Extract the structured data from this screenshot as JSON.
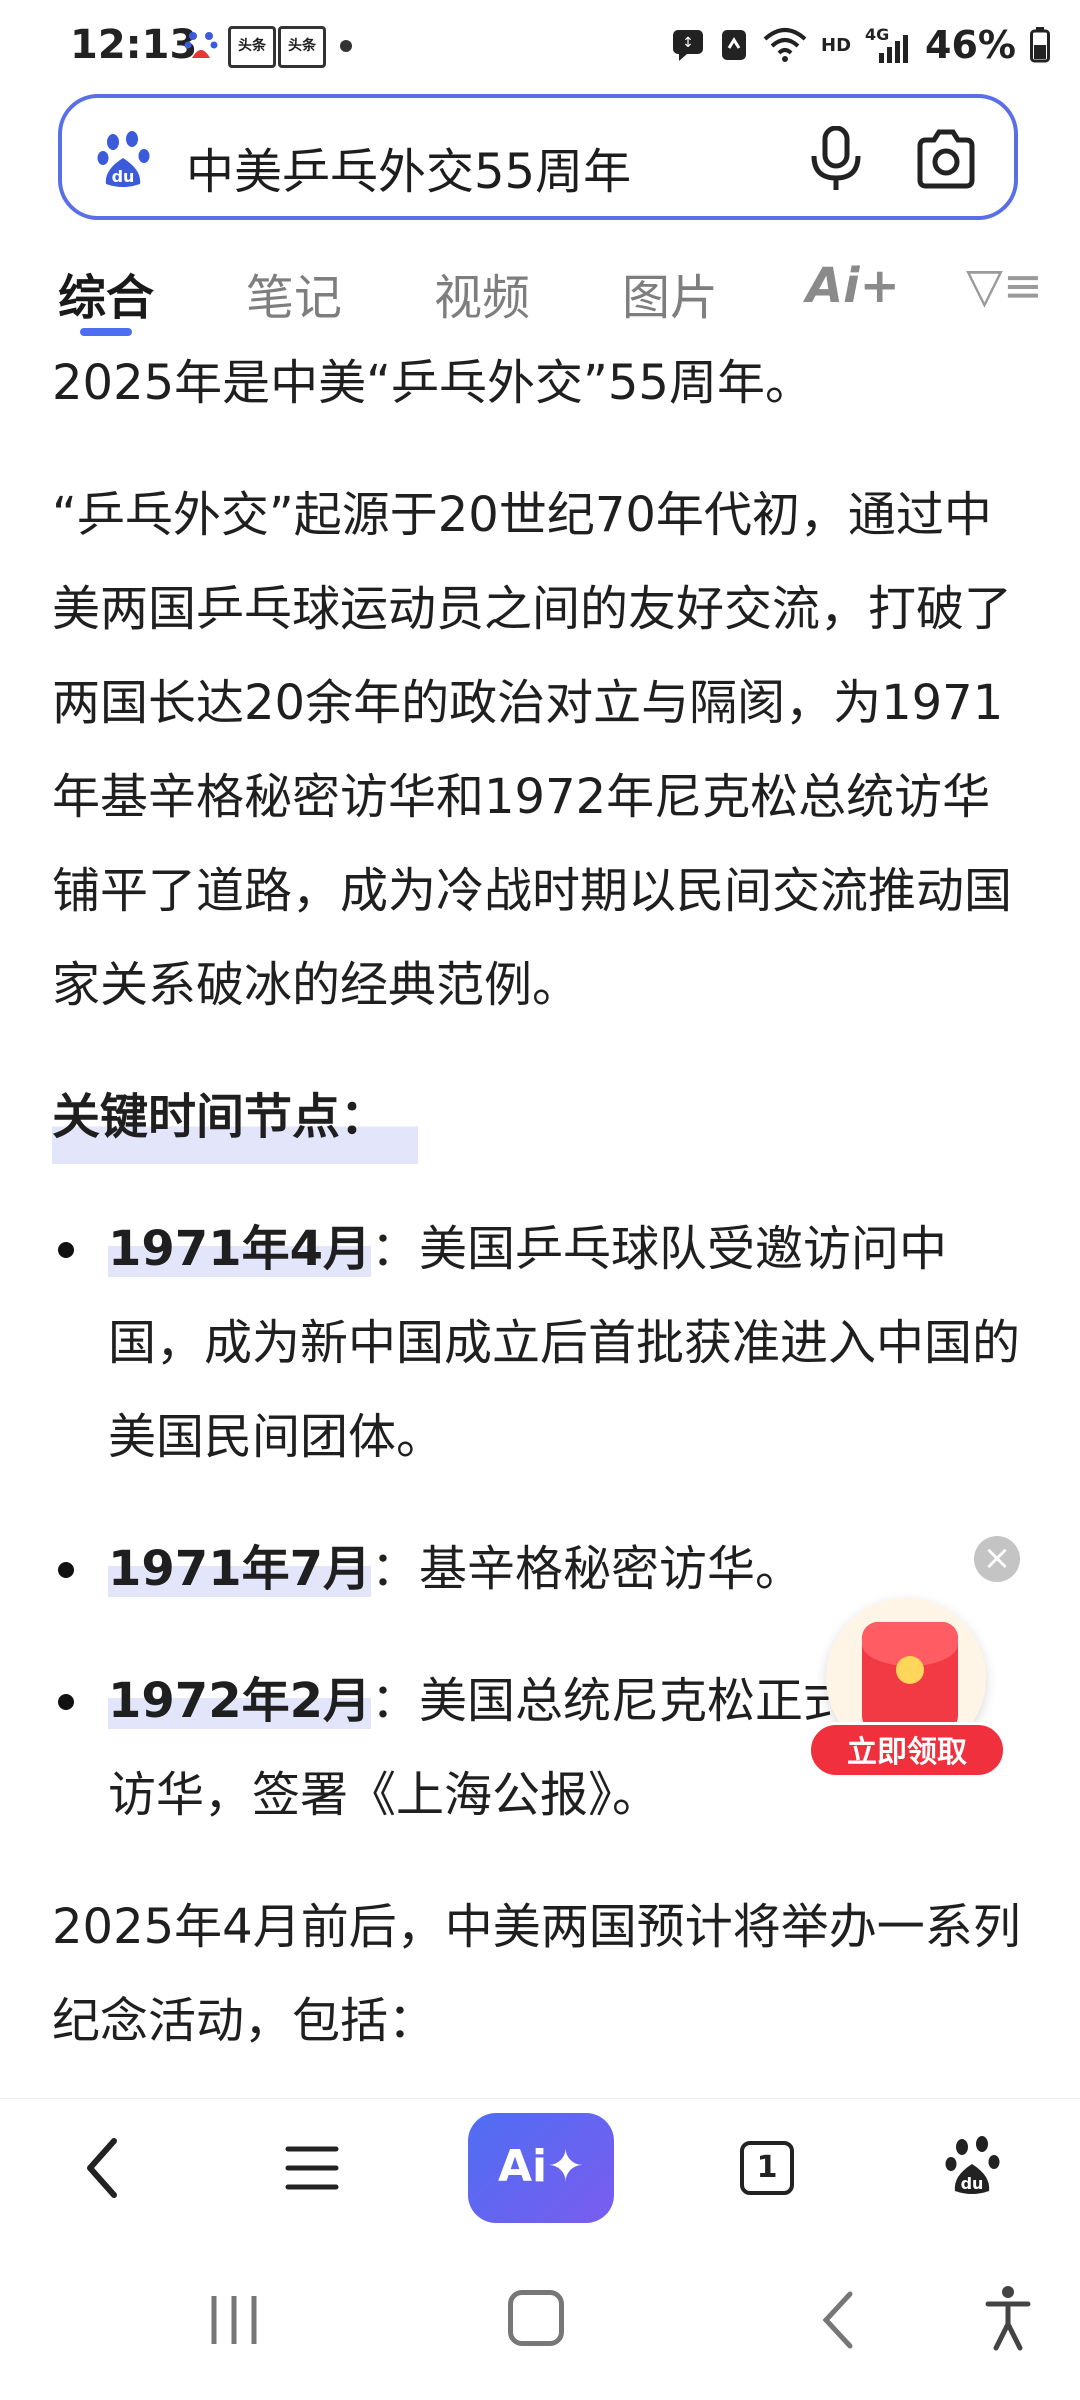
{
  "status_bar": {
    "time": "12:13",
    "news_badge_1": "头条",
    "news_badge_2": "头条",
    "network": "HD",
    "signal": "4G",
    "battery": "46%"
  },
  "search": {
    "query": "中美乒乓外交55周年"
  },
  "tabs": [
    {
      "label": "综合",
      "active": true
    },
    {
      "label": "笔记"
    },
    {
      "label": "视频"
    },
    {
      "label": "图片"
    },
    {
      "label": "Ai+"
    },
    {
      "label": "▽≡"
    }
  ],
  "content": {
    "intro": "2025年是中美“乒乓外交”55周年。",
    "paragraph": "“乒乓外交”起源于20世纪70年代初，通过中美两国乒乓球运动员之间的友好交流，打破了两国长达20余年的政治对立与隔阂，为1971年基辛格秘密访华和1972年尼克松总统访华铺平了道路，成为冷战时期以民间交流推动国家关系破冰的经典范例。",
    "heading": "关键时间节点：",
    "timeline": [
      {
        "date": "1971年4月",
        "text": "：美国乒乓球队受邀访问中国，成为新中国成立后首批获准进入中国的美国民间团体。"
      },
      {
        "date": "1971年7月",
        "text": "：基辛格秘密访华。"
      },
      {
        "date": "1972年2月",
        "text": "：美国总统尼克松正式访华，签署《上海公报》。"
      }
    ],
    "closing": "2025年4月前后，中美两国预计将举办一系列纪念活动，包括："
  },
  "floating": {
    "close": "×",
    "claim_label": "立即领取"
  },
  "bottom_nav": {
    "ai_label": "Ai✦",
    "tab_count": "1"
  },
  "colors": {
    "accent": "#4e6ef2",
    "highlight": "#e3e6fb",
    "red": "#f0303c"
  }
}
